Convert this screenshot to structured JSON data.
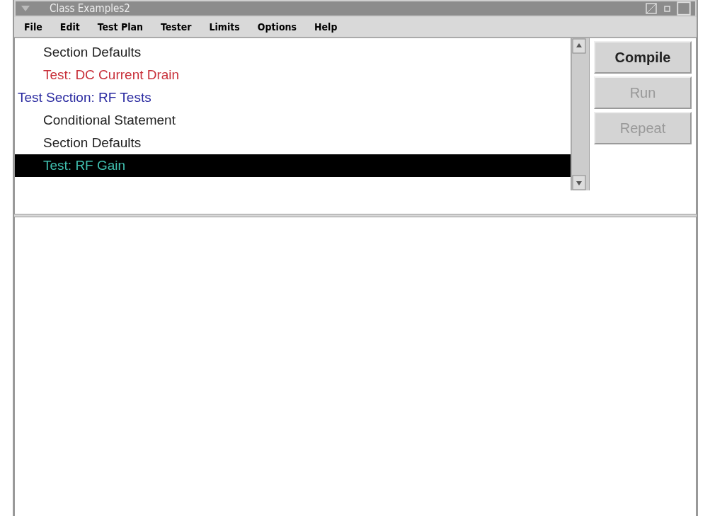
{
  "window": {
    "title": "Class Examples2"
  },
  "menu": [
    {
      "label": "File"
    },
    {
      "label": "Edit"
    },
    {
      "label": "Test Plan"
    },
    {
      "label": "Tester"
    },
    {
      "label": "Limits"
    },
    {
      "label": "Options"
    },
    {
      "label": "Help"
    }
  ],
  "tree": {
    "continued_children": [
      {
        "label": "Section Defaults",
        "color": "#222222",
        "selected": false
      },
      {
        "label": "Test: DC Current Drain",
        "color": "#c8303a",
        "selected": false
      }
    ],
    "nodes": [
      {
        "label": "Test Section: RF Tests",
        "color": "#2a2aa0",
        "selected": false,
        "children": [
          {
            "label": "Conditional Statement",
            "color": "#222222",
            "selected": false
          },
          {
            "label": "Section Defaults",
            "color": "#222222",
            "selected": false
          },
          {
            "label": "Test: RF Gain",
            "color": "#40c0b0",
            "selected": true
          }
        ]
      }
    ]
  },
  "buttons": [
    {
      "label": "Compile",
      "disabled": false
    },
    {
      "label": "Run",
      "disabled": true
    },
    {
      "label": "Repeat",
      "disabled": true
    }
  ]
}
